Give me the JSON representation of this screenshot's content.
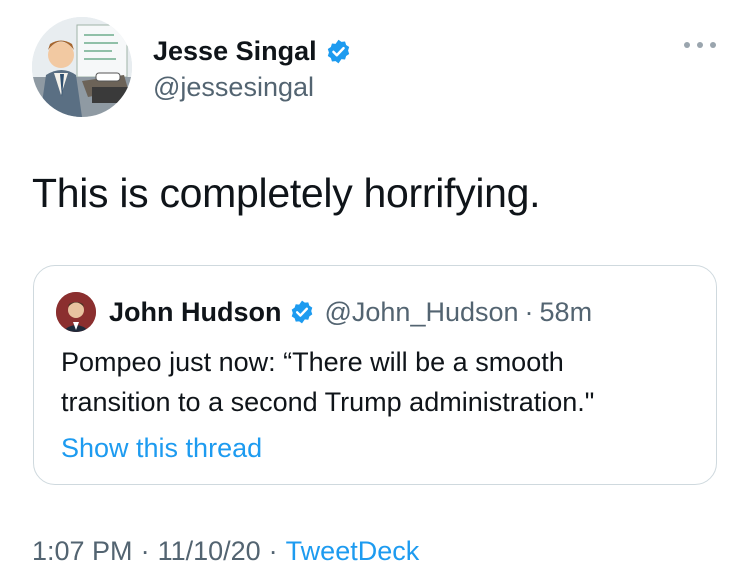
{
  "author": {
    "name": "Jesse Singal",
    "handle": "@jessesingal"
  },
  "tweet": {
    "text": "This is completely horrifying."
  },
  "quoted": {
    "name": "John Hudson",
    "handle": "@John_Hudson",
    "separator": "·",
    "time": "58m",
    "text_lines": [
      "Pompeo just now: “There will be a smooth",
      "transition to a second Trump administration.\""
    ],
    "show_thread": "Show this thread"
  },
  "meta": {
    "time": "1:07 PM",
    "dot1": "·",
    "date": "11/10/20",
    "dot2": "·",
    "source": "TweetDeck"
  },
  "icons": {
    "verified": "verified-badge-icon",
    "more": "more-options-icon"
  },
  "colors": {
    "accent": "#1d9bf0",
    "secondary_text": "#536471",
    "primary_text": "#0f1419",
    "border": "#cfd9de"
  }
}
